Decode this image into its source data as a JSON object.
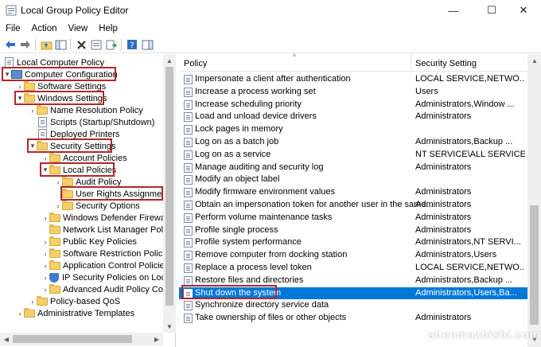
{
  "window": {
    "title": "Local Group Policy Editor",
    "minimize_glyph": "—",
    "maximize_glyph": "☐",
    "close_glyph": "✕"
  },
  "menu": [
    "File",
    "Action",
    "View",
    "Help"
  ],
  "toolbar": {
    "icons": [
      "back-icon",
      "forward-icon",
      "up-folder-icon",
      "show-hide-tree-icon",
      "delete-icon",
      "properties-icon",
      "export-list-icon",
      "help-icon",
      "show-pane-icon"
    ]
  },
  "tree": [
    {
      "label": "Local Computer Policy",
      "icon": "doc",
      "arrow": "",
      "level": 0
    },
    {
      "label": "Computer Configuration",
      "icon": "pc",
      "arrow": "▾",
      "level": 0
    },
    {
      "label": "Software Settings",
      "icon": "folder",
      "arrow": "›",
      "level": 1
    },
    {
      "label": "Windows Settings",
      "icon": "folder",
      "arrow": "▾",
      "level": 1
    },
    {
      "label": "Name Resolution Policy",
      "icon": "folder",
      "arrow": "›",
      "level": 2
    },
    {
      "label": "Scripts (Startup/Shutdown)",
      "icon": "doc",
      "arrow": "",
      "level": 2
    },
    {
      "label": "Deployed Printers",
      "icon": "doc",
      "arrow": "",
      "level": 2
    },
    {
      "label": "Security Settings",
      "icon": "folder",
      "arrow": "▾",
      "level": 2
    },
    {
      "label": "Account Policies",
      "icon": "folder",
      "arrow": "›",
      "level": 3
    },
    {
      "label": "Local Policies",
      "icon": "folder",
      "arrow": "▾",
      "level": 3
    },
    {
      "label": "Audit Policy",
      "icon": "folder",
      "arrow": "›",
      "level": 4
    },
    {
      "label": "User Rights Assignment",
      "icon": "folder",
      "arrow": "",
      "level": 4
    },
    {
      "label": "Security Options",
      "icon": "folder",
      "arrow": "›",
      "level": 4
    },
    {
      "label": "Windows Defender Firewall w",
      "icon": "folder",
      "arrow": "›",
      "level": 3
    },
    {
      "label": "Network List Manager Policie",
      "icon": "folder",
      "arrow": "",
      "level": 3
    },
    {
      "label": "Public Key Policies",
      "icon": "folder",
      "arrow": "›",
      "level": 3
    },
    {
      "label": "Software Restriction Policies",
      "icon": "folder",
      "arrow": "›",
      "level": 3
    },
    {
      "label": "Application Control Policies",
      "icon": "folder",
      "arrow": "›",
      "level": 3
    },
    {
      "label": "IP Security Policies on Local",
      "icon": "shield",
      "arrow": "›",
      "level": 3
    },
    {
      "label": "Advanced Audit Policy Conf",
      "icon": "folder",
      "arrow": "›",
      "level": 3
    },
    {
      "label": "Policy-based QoS",
      "icon": "folder",
      "arrow": "›",
      "level": 2
    },
    {
      "label": "Administrative Templates",
      "icon": "folder",
      "arrow": "›",
      "level": 1
    }
  ],
  "list": {
    "columns": [
      "Policy",
      "Security Setting"
    ],
    "rows": [
      {
        "policy": "Impersonate a client after authentication",
        "setting": "LOCAL SERVICE,NETWO..."
      },
      {
        "policy": "Increase a process working set",
        "setting": "Users"
      },
      {
        "policy": "Increase scheduling priority",
        "setting": "Administrators,Window ..."
      },
      {
        "policy": "Load and unload device drivers",
        "setting": "Administrators"
      },
      {
        "policy": "Lock pages in memory",
        "setting": ""
      },
      {
        "policy": "Log on as a batch job",
        "setting": "Administrators,Backup ..."
      },
      {
        "policy": "Log on as a service",
        "setting": "NT SERVICE\\ALL SERVICES"
      },
      {
        "policy": "Manage auditing and security log",
        "setting": "Administrators"
      },
      {
        "policy": "Modify an object label",
        "setting": ""
      },
      {
        "policy": "Modify firmware environment values",
        "setting": "Administrators"
      },
      {
        "policy": "Obtain an impersonation token for another user in the same...",
        "setting": "Administrators"
      },
      {
        "policy": "Perform volume maintenance tasks",
        "setting": "Administrators"
      },
      {
        "policy": "Profile single process",
        "setting": "Administrators"
      },
      {
        "policy": "Profile system performance",
        "setting": "Administrators,NT SERVI..."
      },
      {
        "policy": "Remove computer from docking station",
        "setting": "Administrators,Users"
      },
      {
        "policy": "Replace a process level token",
        "setting": "LOCAL SERVICE,NETWO..."
      },
      {
        "policy": "Restore files and directories",
        "setting": "Administrators,Backup ..."
      },
      {
        "policy": "Shut down the system",
        "setting": "Administrators,Users,Ba..."
      },
      {
        "policy": "Synchronize directory service data",
        "setting": ""
      },
      {
        "policy": "Take ownership of files or other objects",
        "setting": "Administrators"
      }
    ],
    "selected_policy": "Shut down the system"
  },
  "watermark": "shenmazhishi.com",
  "colors": {
    "highlight_box": "#b3262c",
    "selection": "#0078d7"
  }
}
